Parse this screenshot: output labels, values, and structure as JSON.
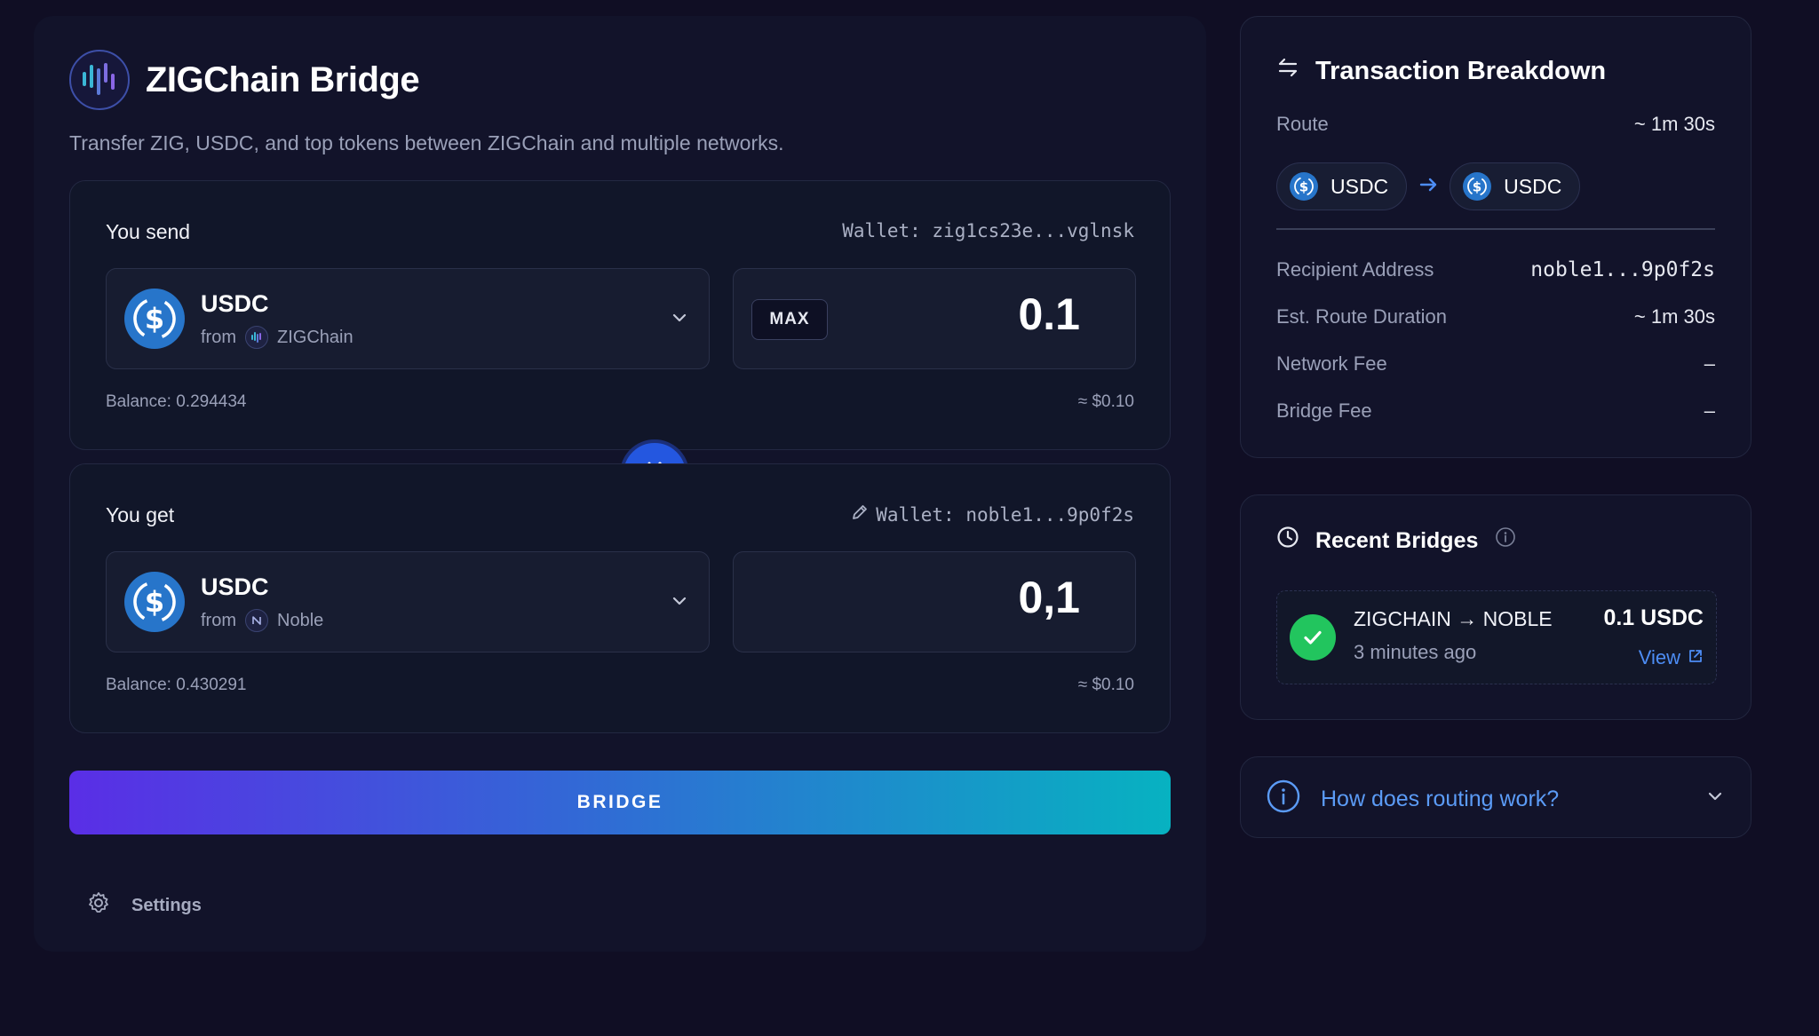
{
  "header": {
    "title": "ZIGChain Bridge",
    "subtitle": "Transfer ZIG, USDC, and top tokens between ZIGChain and multiple networks."
  },
  "send": {
    "label": "You send",
    "wallet": "Wallet: zig1cs23e...vglnsk",
    "token": "USDC",
    "from_prefix": "from",
    "chain": "ZIGChain",
    "max_label": "MAX",
    "amount": "0.1",
    "balance": "Balance: 0.294434",
    "usd": "≈ $0.10"
  },
  "get": {
    "label": "You get",
    "wallet": "Wallet: noble1...9p0f2s",
    "token": "USDC",
    "from_prefix": "from",
    "chain": "Noble",
    "amount": "0,1",
    "balance": "Balance: 0.430291",
    "usd": "≈ $0.10"
  },
  "bridge_button": "BRIDGE",
  "settings_label": "Settings",
  "breakdown": {
    "title": "Transaction Breakdown",
    "route_label": "Route",
    "route_time": "~ 1m 30s",
    "from_token": "USDC",
    "to_token": "USDC",
    "rows": [
      {
        "label": "Recipient Address",
        "value": "noble1...9p0f2s"
      },
      {
        "label": "Est. Route Duration",
        "value": "~ 1m 30s"
      },
      {
        "label": "Network Fee",
        "value": "–"
      },
      {
        "label": "Bridge Fee",
        "value": "–"
      }
    ]
  },
  "recent": {
    "title": "Recent Bridges",
    "item": {
      "route": "ZIGCHAIN → NOBLE",
      "time": "3 minutes ago",
      "amount": "0.1 USDC",
      "view": "View"
    }
  },
  "routing": {
    "question": "How does routing work?"
  },
  "colors": {
    "background": "#100e24",
    "panel": "#12132a",
    "accent_blue": "#2457e0",
    "usdc": "#2775ca",
    "success": "#22c55e",
    "link": "#4d8df5"
  }
}
